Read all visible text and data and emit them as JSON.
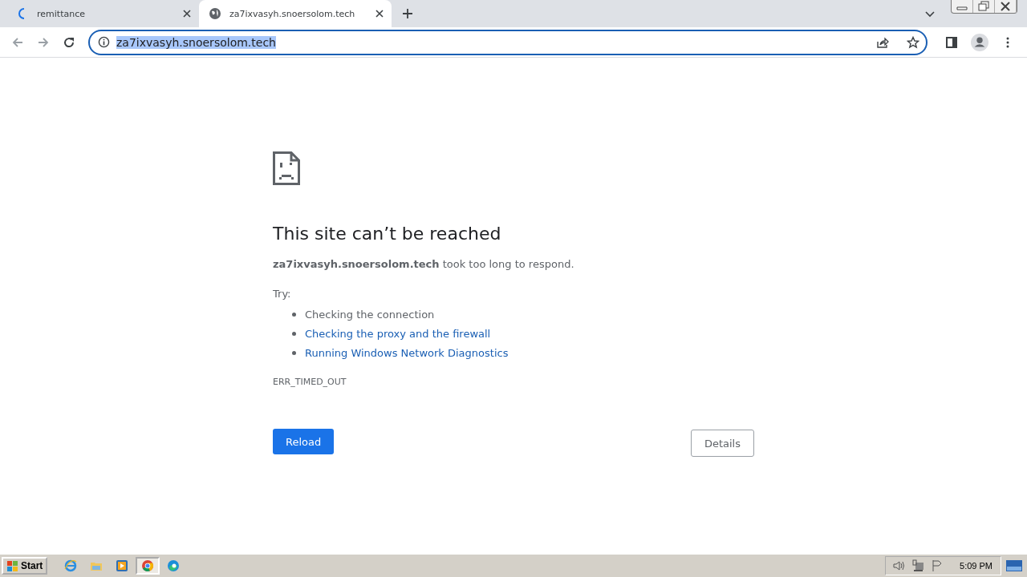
{
  "tabs": [
    {
      "title": "remittance",
      "selected": false,
      "loading": true
    },
    {
      "title": "za7ixvasyh.snoersolom.tech",
      "selected": true,
      "loading": false
    }
  ],
  "address_bar": {
    "url": "za7ixvasyh.snoersolom.tech",
    "url_selected": true
  },
  "error_page": {
    "heading": "This site can’t be reached",
    "message": "**za7ixvasyh.snoersolom.tech** took too long to respond.",
    "try_label": "Try:",
    "suggestions": [
      {
        "text": "Checking the connection",
        "kind": "text"
      },
      {
        "text": "Checking the proxy and the firewall",
        "kind": "link"
      },
      {
        "text": "Running Windows Network Diagnostics",
        "kind": "link"
      }
    ],
    "error_code": "ERR_TIMED_OUT",
    "reload_button": "Reload",
    "details_button": "Details"
  },
  "taskbar": {
    "start_label": "Start",
    "apps": [
      {
        "kind": "ie",
        "selected": false
      },
      {
        "kind": "folder",
        "selected": false
      },
      {
        "kind": "media",
        "selected": false
      },
      {
        "kind": "chrome",
        "selected": true
      },
      {
        "kind": "edge",
        "selected": false
      }
    ],
    "clock": "5:09 PM"
  }
}
